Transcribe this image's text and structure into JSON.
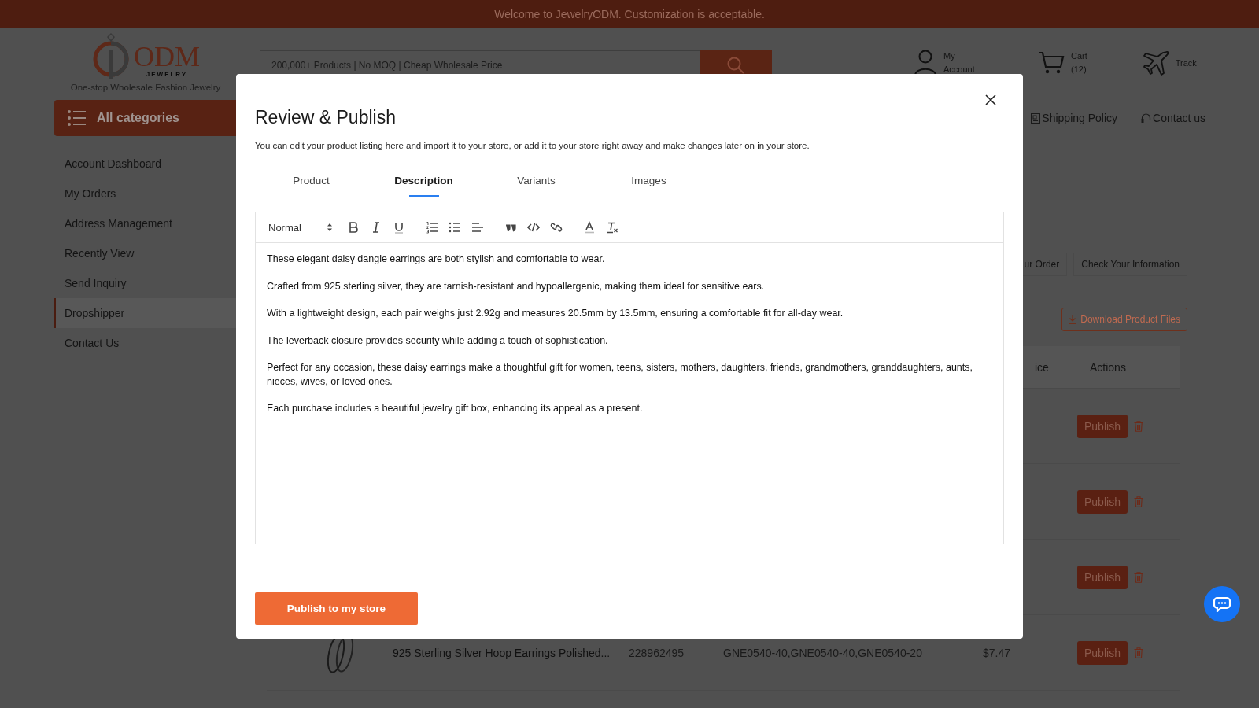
{
  "banner": {
    "text": "Welcome to JewelryODM. Customization is acceptable."
  },
  "header": {
    "logo": {
      "name": "ODM",
      "sub": "JEWELRY",
      "tagline": "One-stop Wholesale Fashion Jewelry"
    },
    "search": {
      "placeholder": "200,000+ Products | No MOQ | Cheap Wholesale Price"
    },
    "account": {
      "label": "My Account"
    },
    "cart": {
      "label": "Cart",
      "count": "(12)"
    },
    "track": {
      "label": "Track"
    }
  },
  "categories_button": {
    "label": "All categories"
  },
  "nav_links": [
    {
      "kind": "policy",
      "label": "Shipping Policy"
    },
    {
      "kind": "contact",
      "label": "Contact us"
    }
  ],
  "sidebar": {
    "items": [
      {
        "label": "Account Dashboard",
        "selected": false
      },
      {
        "label": "My Orders",
        "selected": false
      },
      {
        "label": "Address Management",
        "selected": false
      },
      {
        "label": "Recently View",
        "selected": false
      },
      {
        "label": "Send Inquiry",
        "selected": false
      },
      {
        "label": "Dropshipper",
        "selected": true
      },
      {
        "label": "Contact Us",
        "selected": false
      }
    ]
  },
  "steps": [
    {
      "label": "ur Order"
    },
    {
      "label": "Check Your Information"
    }
  ],
  "download_button": {
    "label": "Download Product Files"
  },
  "table": {
    "columns": [
      "ice",
      "Actions"
    ],
    "rows": [
      {
        "action": "Publish"
      },
      {
        "action": "Publish"
      },
      {
        "action": "Publish"
      },
      {
        "link": "925 Sterling Silver Hoop Earrings Polished...",
        "column_3": "228962495",
        "column_4": "GNE0540-40,GNE0540-40,GNE0540-20",
        "column_5": "$7.47",
        "action": "Publish"
      }
    ]
  },
  "modal": {
    "title": "Review & Publish",
    "description": "You can edit your product listing here and import it to your store, or add it to your store right away and make changes later on in your store.",
    "tabs": [
      {
        "label": "Product",
        "selected": false
      },
      {
        "label": "Description",
        "selected": true
      },
      {
        "label": "Variants",
        "selected": false
      },
      {
        "label": "Images",
        "selected": false
      }
    ],
    "editor": {
      "format": "Normal",
      "paragraphs": [
        "These elegant daisy dangle earrings are both stylish and comfortable to wear.",
        "Crafted from 925 sterling silver, they are tarnish-resistant and hypoallergenic, making them ideal for sensitive ears.",
        "With a lightweight design, each pair weighs just 2.92g and measures 20.5mm by 13.5mm, ensuring a comfortable fit for all-day wear.",
        "The leverback closure provides security while adding a touch of sophistication.",
        "Perfect for any occasion, these daisy earrings make a thoughtful gift for women, teens, sisters, mothers, daughters, friends, grandmothers, granddaughters, aunts, nieces, wives, or loved ones.",
        "Each purchase includes a beautiful jewelry gift box, enhancing its appeal as a present."
      ]
    },
    "publish_button": {
      "label": "Publish to my store"
    }
  }
}
